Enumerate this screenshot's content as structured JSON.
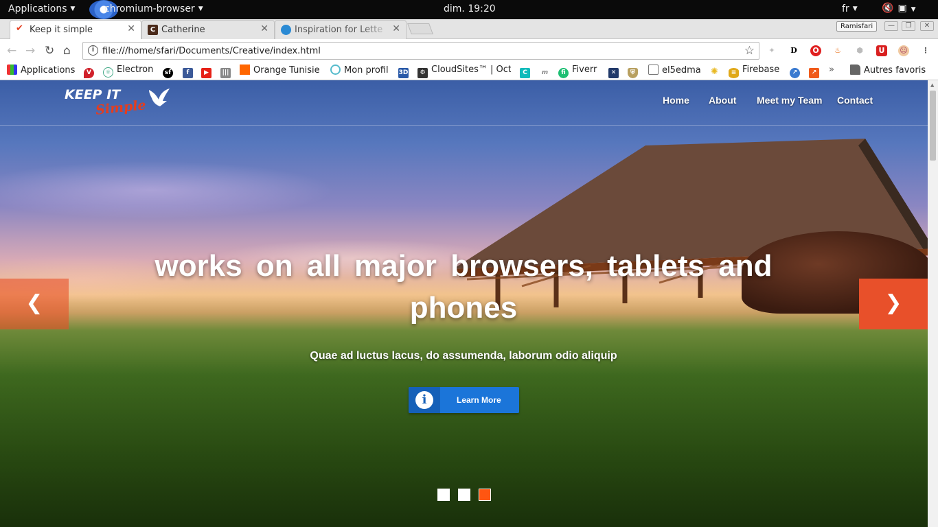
{
  "system_bar": {
    "applications_menu": "Applications",
    "active_app": "chromium-browser",
    "clock": "dim. 19:20",
    "input_language": "fr"
  },
  "tabs": [
    {
      "title": "Keep it simple",
      "active": true,
      "favicon": "red-check-icon"
    },
    {
      "title": "Catherine",
      "active": false,
      "favicon": "c-letter-icon"
    },
    {
      "title": "Inspiration for Lette",
      "active": false,
      "favicon": "blue-drop-icon"
    }
  ],
  "profile_name": "Ramisfari",
  "address_bar": {
    "url": "file:///home/sfari/Documents/Creative/index.html"
  },
  "bookmarks": [
    {
      "label": "Applications",
      "icon": "apps-grid-icon"
    },
    {
      "label": "",
      "icon": "vivaldi-icon"
    },
    {
      "label": "Electron",
      "icon": "electron-icon"
    },
    {
      "label": "",
      "icon": "symfony-icon"
    },
    {
      "label": "",
      "icon": "facebook-icon"
    },
    {
      "label": "",
      "icon": "youtube-icon"
    },
    {
      "label": "",
      "icon": "bar-icon"
    },
    {
      "label": "Orange Tunisie",
      "icon": "orange-icon"
    },
    {
      "label": "Mon profil",
      "icon": "profile-icon"
    },
    {
      "label": "",
      "icon": "3d-icon"
    },
    {
      "label": "CloudSites™ | Oct",
      "icon": "cloudsites-icon"
    },
    {
      "label": "",
      "icon": "c-square-icon"
    },
    {
      "label": "",
      "icon": "m-icon"
    },
    {
      "label": "Fiverr",
      "icon": "fiverr-icon"
    },
    {
      "label": "",
      "icon": "tools-icon"
    },
    {
      "label": "",
      "icon": "shield-icon"
    },
    {
      "label": "el5edma",
      "icon": "page-icon"
    },
    {
      "label": "",
      "icon": "bulb-icon"
    },
    {
      "label": "Firebase",
      "icon": "database-icon"
    },
    {
      "label": "",
      "icon": "rocket-icon"
    },
    {
      "label": "",
      "icon": "orange-chart-icon"
    }
  ],
  "bookmarks_overflow": "»",
  "other_bookmarks": "Autres favoris",
  "site": {
    "logo_line1": "KEEP IT",
    "logo_line2": "Simple",
    "nav": [
      "Home",
      "About",
      "Meet my Team",
      "Contact"
    ],
    "headline": "works on all major browsers, tablets and phones",
    "subheadline": "Quae ad luctus lacus, do assumenda, laborum odio aliquip",
    "cta_label": "Learn More",
    "slide_count": 3,
    "active_slide": 3,
    "accent_color": "#e8502a",
    "cta_color": "#1b75d9"
  }
}
